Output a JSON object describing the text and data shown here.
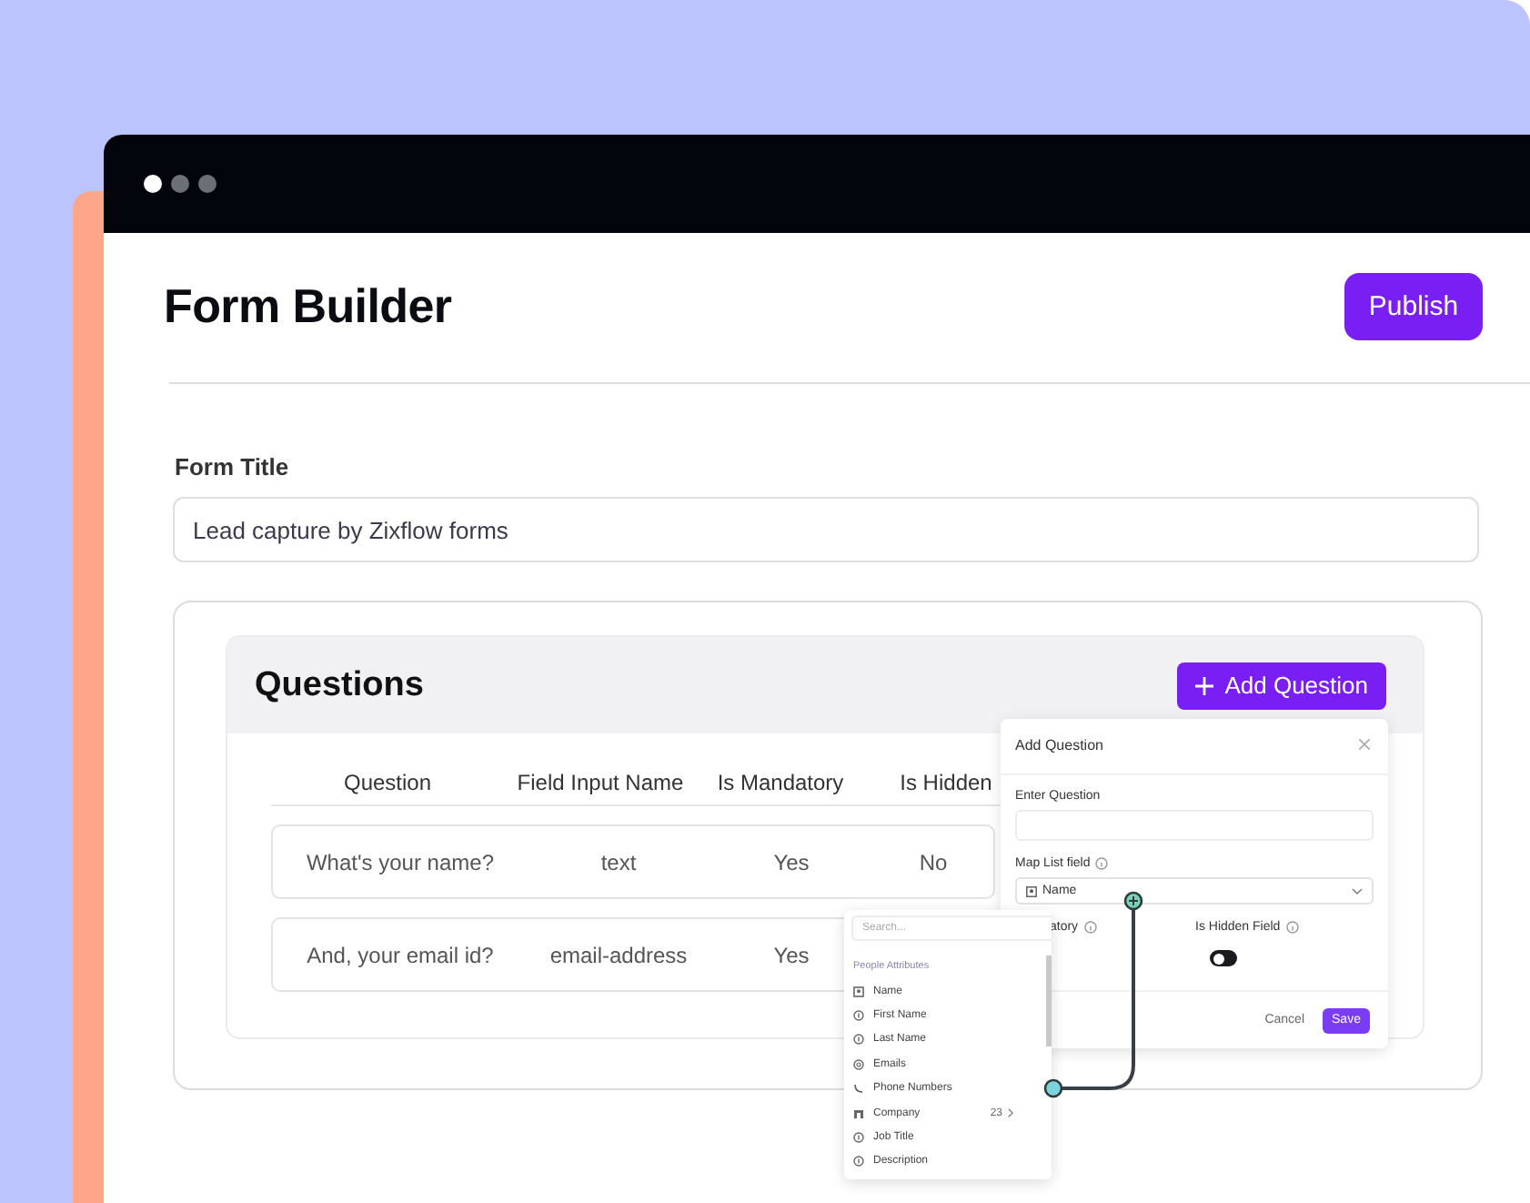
{
  "window": {
    "title": "Form Builder",
    "publish_button": "Publish"
  },
  "form_title": {
    "label": "Form Title",
    "value": "Lead capture by Zixflow forms"
  },
  "questions": {
    "title": "Questions",
    "add_button": "Add Question",
    "columns": [
      "Question",
      "Field Input Name",
      "Is Mandatory",
      "Is Hidden"
    ],
    "rows": [
      {
        "cells": [
          "What's your name?",
          "text",
          "Yes",
          "No"
        ]
      },
      {
        "cells": [
          "And, your email id?",
          "email-address",
          "Yes"
        ]
      }
    ]
  },
  "add_question_dialog": {
    "title": "Add Question",
    "question_label": "Enter Question",
    "map_label": "Map List field",
    "map_value": "Name",
    "mandatory_label": "atory",
    "hidden_label": "Is Hidden Field",
    "hidden_on": false,
    "cancel": "Cancel",
    "save": "Save"
  },
  "attribute_menu": {
    "placeholder": "Search...",
    "group": "People Attributes",
    "items": [
      {
        "label": "Name"
      },
      {
        "label": "First Name"
      },
      {
        "label": "Last Name"
      },
      {
        "label": "Emails"
      },
      {
        "label": "Phone Numbers"
      },
      {
        "label": "Company",
        "count": "23"
      },
      {
        "label": "Job Title"
      },
      {
        "label": "Description"
      }
    ]
  }
}
